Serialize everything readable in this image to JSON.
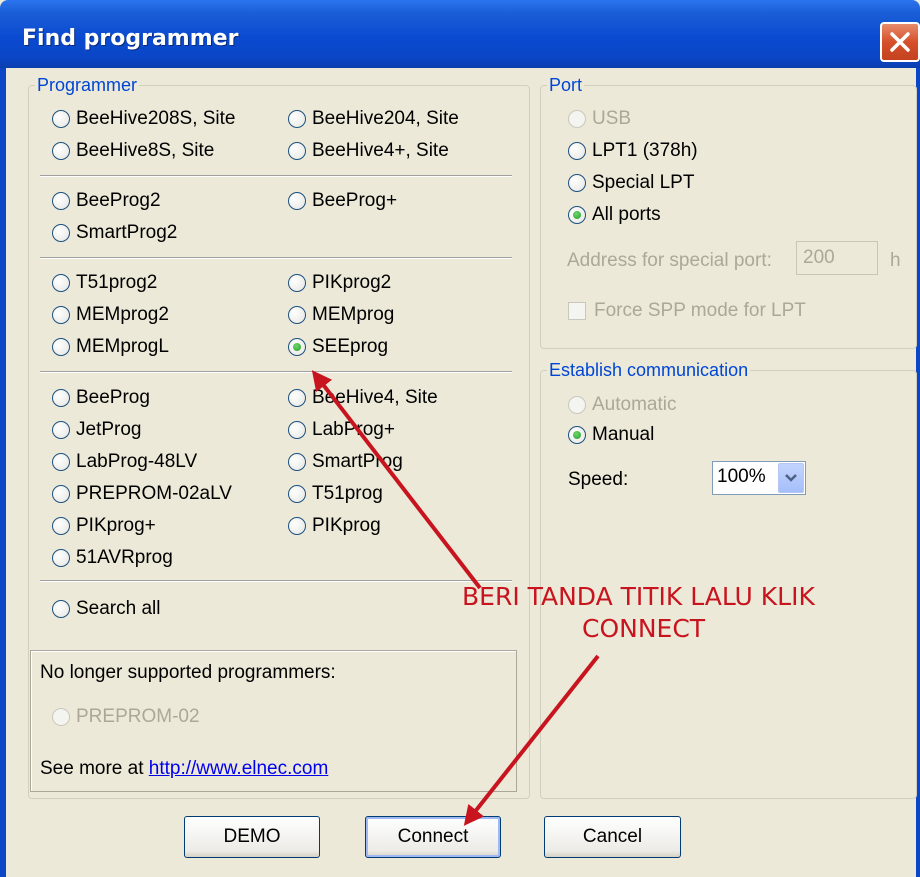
{
  "window": {
    "title": "Find programmer"
  },
  "programmer": {
    "legend": "Programmer",
    "options": [
      [
        "BeeHive208S, Site",
        "BeeHive204, Site",
        "BeeHive8S, Site",
        "BeeHive4+, Site"
      ],
      [
        "BeeProg2",
        "BeeProg+",
        "SmartProg2"
      ],
      [
        "T51prog2",
        "PIKprog2",
        "MEMprog2",
        "MEMprog",
        "MEMprogL",
        "SEEprog"
      ],
      [
        "BeeProg",
        "BeeHive4, Site",
        "JetProg",
        "LabProg+",
        "LabProg-48LV",
        "SmartProg",
        "PREPROM-02aLV",
        "T51prog",
        "PIKprog+",
        "PIKprog",
        "51AVRprog"
      ]
    ],
    "search_all": "Search all",
    "selected": "SEEprog"
  },
  "no_longer": {
    "heading": "No longer supported programmers:",
    "option": "PREPROM-02",
    "see_more": "See more at",
    "link": "http://www.elnec.com"
  },
  "port": {
    "legend": "Port",
    "usb": "USB",
    "lpt1": "LPT1 (378h)",
    "special": "Special LPT",
    "all": "All ports",
    "selected": "All ports",
    "address_label": "Address for special port:",
    "address_value": "200",
    "address_suffix": "h",
    "force_spp": "Force SPP mode for LPT"
  },
  "comm": {
    "legend": "Establish communication",
    "automatic": "Automatic",
    "manual": "Manual",
    "selected": "Manual",
    "speed_label": "Speed:",
    "speed_value": "100%"
  },
  "buttons": {
    "demo": "DEMO",
    "connect": "Connect",
    "cancel": "Cancel"
  },
  "annotation": {
    "line1": "BERI TANDA TITIK LALU KLIK",
    "line2": "CONNECT",
    "color": "#c8141e"
  },
  "icons": {
    "close": "close-icon",
    "dropdown": "chevron-down-icon",
    "arrow": "red-arrow-icon"
  }
}
